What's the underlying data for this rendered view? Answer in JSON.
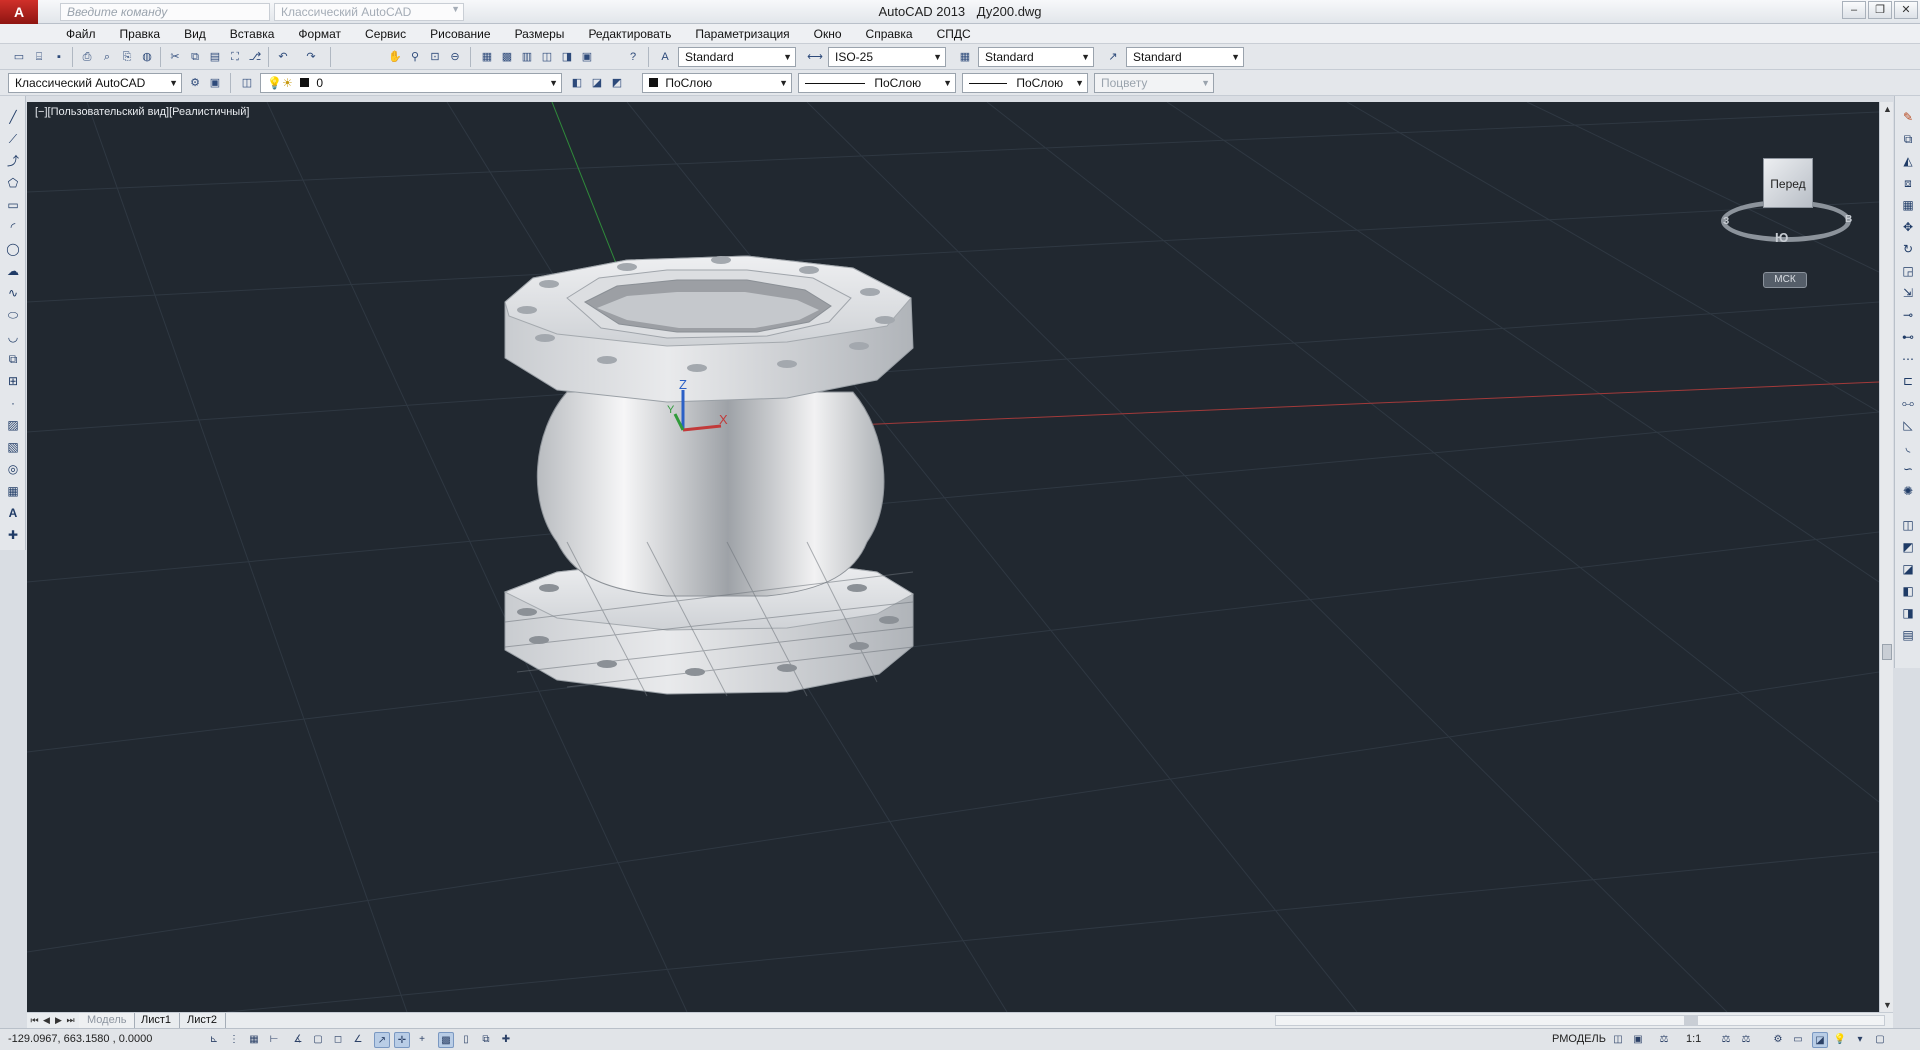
{
  "titlebar": {
    "logo": "A",
    "command_placeholder": "Введите команду",
    "workspace_top": "Классический AutoCAD",
    "app_title": "AutoCAD 2013",
    "file_name": "Ду200.dwg",
    "minimize": "–",
    "restore": "❐",
    "close": "✕"
  },
  "menu": [
    "Файл",
    "Правка",
    "Вид",
    "Вставка",
    "Формат",
    "Сервис",
    "Рисование",
    "Размеры",
    "Редактировать",
    "Параметризация",
    "Окно",
    "Справка",
    "СПДС"
  ],
  "toolbar1": {
    "text_style": "Standard",
    "dim_style": "ISO-25",
    "table_style": "Standard",
    "mleader_style": "Standard"
  },
  "toolbar2": {
    "workspace": "Классический AutoCAD",
    "layer": "0",
    "color": "ПоСлою",
    "linetype": "ПоСлою",
    "lineweight": "ПоСлою",
    "plotstyle": "Поцвету"
  },
  "viewport": {
    "label": "[−][Пользовательский вид][Реалистичный]",
    "viewcube_face": "Перед",
    "compass_s": "Ю",
    "compass_w": "З",
    "compass_e": "В",
    "ucs_button": "МСК",
    "axis_z": "Z",
    "axis_x": "X",
    "axis_y": "Y",
    "colors": {
      "background": "#212830",
      "grid": "#2f3842",
      "x_axis": "#a33a3a",
      "y_axis": "#2f8a3a"
    }
  },
  "tabs": [
    "Модель",
    "Лист1",
    "Лист2"
  ],
  "status": {
    "coordinates": "-129.0967, 663.1580 , 0.0000",
    "model": "РМОДЕЛЬ",
    "scale": "1:1"
  }
}
